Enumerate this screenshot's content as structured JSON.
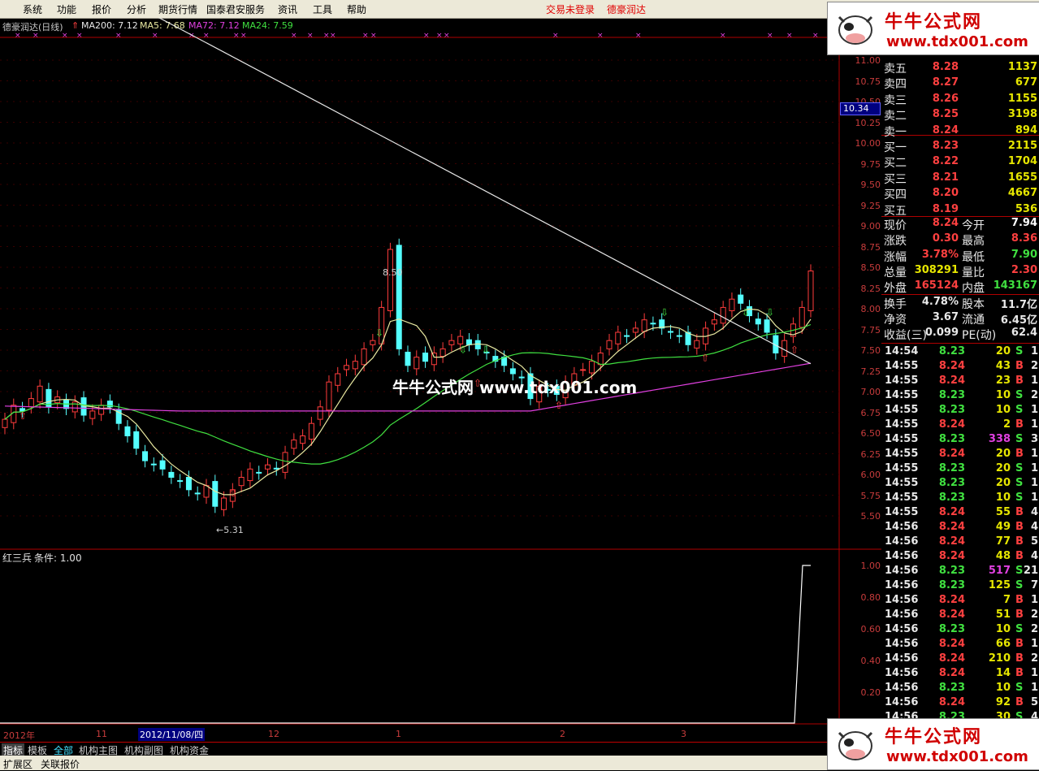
{
  "menu": {
    "items": [
      "系统",
      "功能",
      "报价",
      "分析",
      "期货行情",
      "国泰君安服务",
      "资讯",
      "工具",
      "帮助"
    ],
    "login_status": "交易未登录",
    "stock_name": "德豪润达"
  },
  "main_chart": {
    "title": "德豪润达(日线)",
    "indicators": [
      {
        "label": "MA200: 7.12",
        "color": "#e8e8e8"
      },
      {
        "label": "MA5: 7.68",
        "color": "#e8e8a0"
      },
      {
        "label": "MA72: 7.12",
        "color": "#e040e0"
      },
      {
        "label": "MA24: 7.59",
        "color": "#40e040"
      }
    ],
    "yticks": [
      "11.00",
      "10.75",
      "10.50",
      "10.25",
      "10.00",
      "9.75",
      "9.50",
      "9.25",
      "9.00",
      "8.75",
      "8.50",
      "8.25",
      "8.00",
      "7.75",
      "7.50",
      "7.25",
      "7.00",
      "6.75",
      "6.50",
      "6.25",
      "6.00",
      "5.75",
      "5.50"
    ],
    "current_price_tag": "10.34",
    "high_label": "8.50",
    "low_label": "5.31",
    "watermark": "牛牛公式网 www.tdx001.com",
    "colors": {
      "up": "#ff3c3c",
      "down": "#54ffff",
      "ma200": "#e8e8e8",
      "ma5": "#e8e8a0",
      "ma24": "#40e040",
      "ma72": "#e040e0"
    }
  },
  "sub_chart": {
    "title": "红三兵",
    "condition_label": "条件: 1.00",
    "yticks": [
      "1.00",
      "0.80",
      "0.60",
      "0.40",
      "0.20"
    ]
  },
  "date_axis": {
    "year": "2012年",
    "cursor_date": "2012/11/08/四",
    "months": [
      "11",
      "12",
      "1",
      "2",
      "3"
    ]
  },
  "quote": {
    "asks": [
      {
        "label": "卖五",
        "price": "8.28",
        "vol": "1137"
      },
      {
        "label": "卖四",
        "price": "8.27",
        "vol": "677"
      },
      {
        "label": "卖三",
        "price": "8.26",
        "vol": "1155"
      },
      {
        "label": "卖二",
        "price": "8.25",
        "vol": "3198"
      },
      {
        "label": "卖一",
        "price": "8.24",
        "vol": "894"
      }
    ],
    "bids": [
      {
        "label": "买一",
        "price": "8.23",
        "vol": "2115"
      },
      {
        "label": "买二",
        "price": "8.22",
        "vol": "1704"
      },
      {
        "label": "买三",
        "price": "8.21",
        "vol": "1655"
      },
      {
        "label": "买四",
        "price": "8.20",
        "vol": "4667"
      },
      {
        "label": "买五",
        "price": "8.19",
        "vol": "536"
      }
    ],
    "stats": [
      {
        "l1": "现价",
        "v1": "8.24",
        "c1": "#ff4040",
        "l2": "今开",
        "v2": "7.94",
        "c2": "#ffffff"
      },
      {
        "l1": "涨跌",
        "v1": "0.30",
        "c1": "#ff4040",
        "l2": "最高",
        "v2": "8.36",
        "c2": "#ff4040"
      },
      {
        "l1": "涨幅",
        "v1": "3.78%",
        "c1": "#ff4040",
        "l2": "最低",
        "v2": "7.90",
        "c2": "#40e040"
      },
      {
        "l1": "总量",
        "v1": "308291",
        "c1": "#e6e600",
        "l2": "量比",
        "v2": "2.30",
        "c2": "#ff4040"
      },
      {
        "l1": "外盘",
        "v1": "165124",
        "c1": "#ff4040",
        "l2": "内盘",
        "v2": "143167",
        "c2": "#40e040"
      },
      {
        "l1": "换手",
        "v1": "4.78%",
        "c1": "#e8e8e8",
        "l2": "股本",
        "v2": "11.7亿",
        "c2": "#e8e8e8"
      },
      {
        "l1": "净资",
        "v1": "3.67",
        "c1": "#e8e8e8",
        "l2": "流通",
        "v2": "6.45亿",
        "c2": "#e8e8e8"
      },
      {
        "l1": "收益(三)",
        "v1": "0.099",
        "c1": "#e8e8e8",
        "l2": "PE(动)",
        "v2": "62.4",
        "c2": "#e8e8e8"
      }
    ]
  },
  "ticks": [
    {
      "time": "14:54",
      "price": "8.23",
      "vol": "20",
      "side": "S",
      "n": "1"
    },
    {
      "time": "14:55",
      "price": "8.24",
      "vol": "43",
      "side": "B",
      "n": "2"
    },
    {
      "time": "14:55",
      "price": "8.24",
      "vol": "23",
      "side": "B",
      "n": "1"
    },
    {
      "time": "14:55",
      "price": "8.23",
      "vol": "10",
      "side": "S",
      "n": "2"
    },
    {
      "time": "14:55",
      "price": "8.23",
      "vol": "10",
      "side": "S",
      "n": "1"
    },
    {
      "time": "14:55",
      "price": "8.24",
      "vol": "2",
      "side": "B",
      "n": "1"
    },
    {
      "time": "14:55",
      "price": "8.23",
      "vol": "338",
      "side": "S",
      "n": "3"
    },
    {
      "time": "14:55",
      "price": "8.24",
      "vol": "20",
      "side": "B",
      "n": "1"
    },
    {
      "time": "14:55",
      "price": "8.23",
      "vol": "20",
      "side": "S",
      "n": "1"
    },
    {
      "time": "14:55",
      "price": "8.23",
      "vol": "20",
      "side": "S",
      "n": "1"
    },
    {
      "time": "14:55",
      "price": "8.23",
      "vol": "10",
      "side": "S",
      "n": "1"
    },
    {
      "time": "14:55",
      "price": "8.24",
      "vol": "55",
      "side": "B",
      "n": "4"
    },
    {
      "time": "14:56",
      "price": "8.24",
      "vol": "49",
      "side": "B",
      "n": "4"
    },
    {
      "time": "14:56",
      "price": "8.24",
      "vol": "77",
      "side": "B",
      "n": "5"
    },
    {
      "time": "14:56",
      "price": "8.24",
      "vol": "48",
      "side": "B",
      "n": "4"
    },
    {
      "time": "14:56",
      "price": "8.23",
      "vol": "517",
      "side": "S",
      "n": "21"
    },
    {
      "time": "14:56",
      "price": "8.23",
      "vol": "125",
      "side": "S",
      "n": "7"
    },
    {
      "time": "14:56",
      "price": "8.24",
      "vol": "7",
      "side": "B",
      "n": "1"
    },
    {
      "time": "14:56",
      "price": "8.24",
      "vol": "51",
      "side": "B",
      "n": "2"
    },
    {
      "time": "14:56",
      "price": "8.23",
      "vol": "10",
      "side": "S",
      "n": "2"
    },
    {
      "time": "14:56",
      "price": "8.24",
      "vol": "66",
      "side": "B",
      "n": "1"
    },
    {
      "time": "14:56",
      "price": "8.24",
      "vol": "210",
      "side": "B",
      "n": "2"
    },
    {
      "time": "14:56",
      "price": "8.24",
      "vol": "14",
      "side": "B",
      "n": "1"
    },
    {
      "time": "14:56",
      "price": "8.23",
      "vol": "10",
      "side": "S",
      "n": "1"
    },
    {
      "time": "14:56",
      "price": "8.24",
      "vol": "92",
      "side": "B",
      "n": "5"
    },
    {
      "time": "14:56",
      "price": "8.23",
      "vol": "30",
      "side": "S",
      "n": "4"
    }
  ],
  "bottom_tabs": [
    "指标",
    "模板",
    "全部",
    "机构主图",
    "机构副图",
    "机构资金"
  ],
  "status_tabs": [
    "扩展区",
    "关联报价"
  ],
  "logo": {
    "cn": "牛牛公式网",
    "url": "www.tdx001.com"
  }
}
